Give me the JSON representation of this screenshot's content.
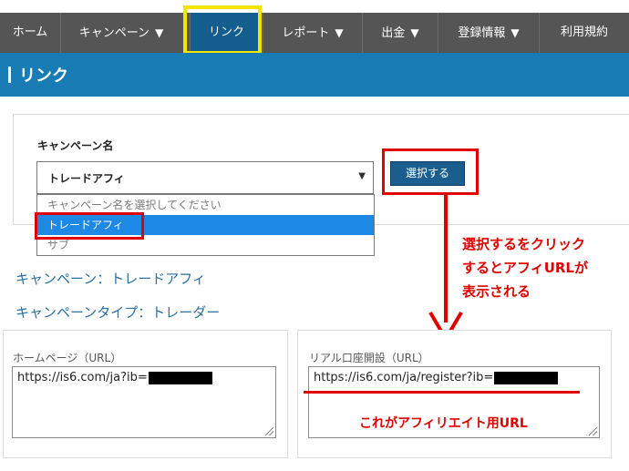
{
  "nav": {
    "items": [
      {
        "label": "ホーム",
        "caret": ""
      },
      {
        "label": "キャンペーン",
        "caret": "▼"
      },
      {
        "label": "リンク",
        "caret": ""
      },
      {
        "label": "レポート",
        "caret": "▼"
      },
      {
        "label": "出金",
        "caret": "▼"
      },
      {
        "label": "登録情報",
        "caret": "▼"
      },
      {
        "label": "利用規約",
        "caret": ""
      }
    ],
    "active_index": 2
  },
  "page": {
    "title": "リンク"
  },
  "campaign_select": {
    "label": "キャンペーン名",
    "value": "トレードアフィ",
    "options": [
      "キャンペーン名を選択してください",
      "トレードアフィ",
      "サブ"
    ],
    "selected_index": 1,
    "button_label": "選択する"
  },
  "info": {
    "campaign": "キャンペーン：トレードアフィ",
    "campaign_type": "キャンペーンタイプ：トレーダー"
  },
  "annotations": {
    "click_note": [
      "選択するをクリック",
      "するとアフィURLが",
      "表示される"
    ],
    "url_note": "これがアフィリエイト用URL"
  },
  "links": {
    "homepage": {
      "label": "ホームページ（URL）",
      "url": "https://is6.com/ja?ib="
    },
    "real_account": {
      "label": "リアル口座開設（URL）",
      "url": "https://is6.com/ja/register?ib="
    }
  },
  "colors": {
    "nav_bg": "#555555",
    "nav_active": "#135d8f",
    "header_bg": "#1a7cb5",
    "highlight_frame": "#f4e400",
    "annotation_red": "#e00000",
    "dropdown_selected": "#1e88e5"
  }
}
